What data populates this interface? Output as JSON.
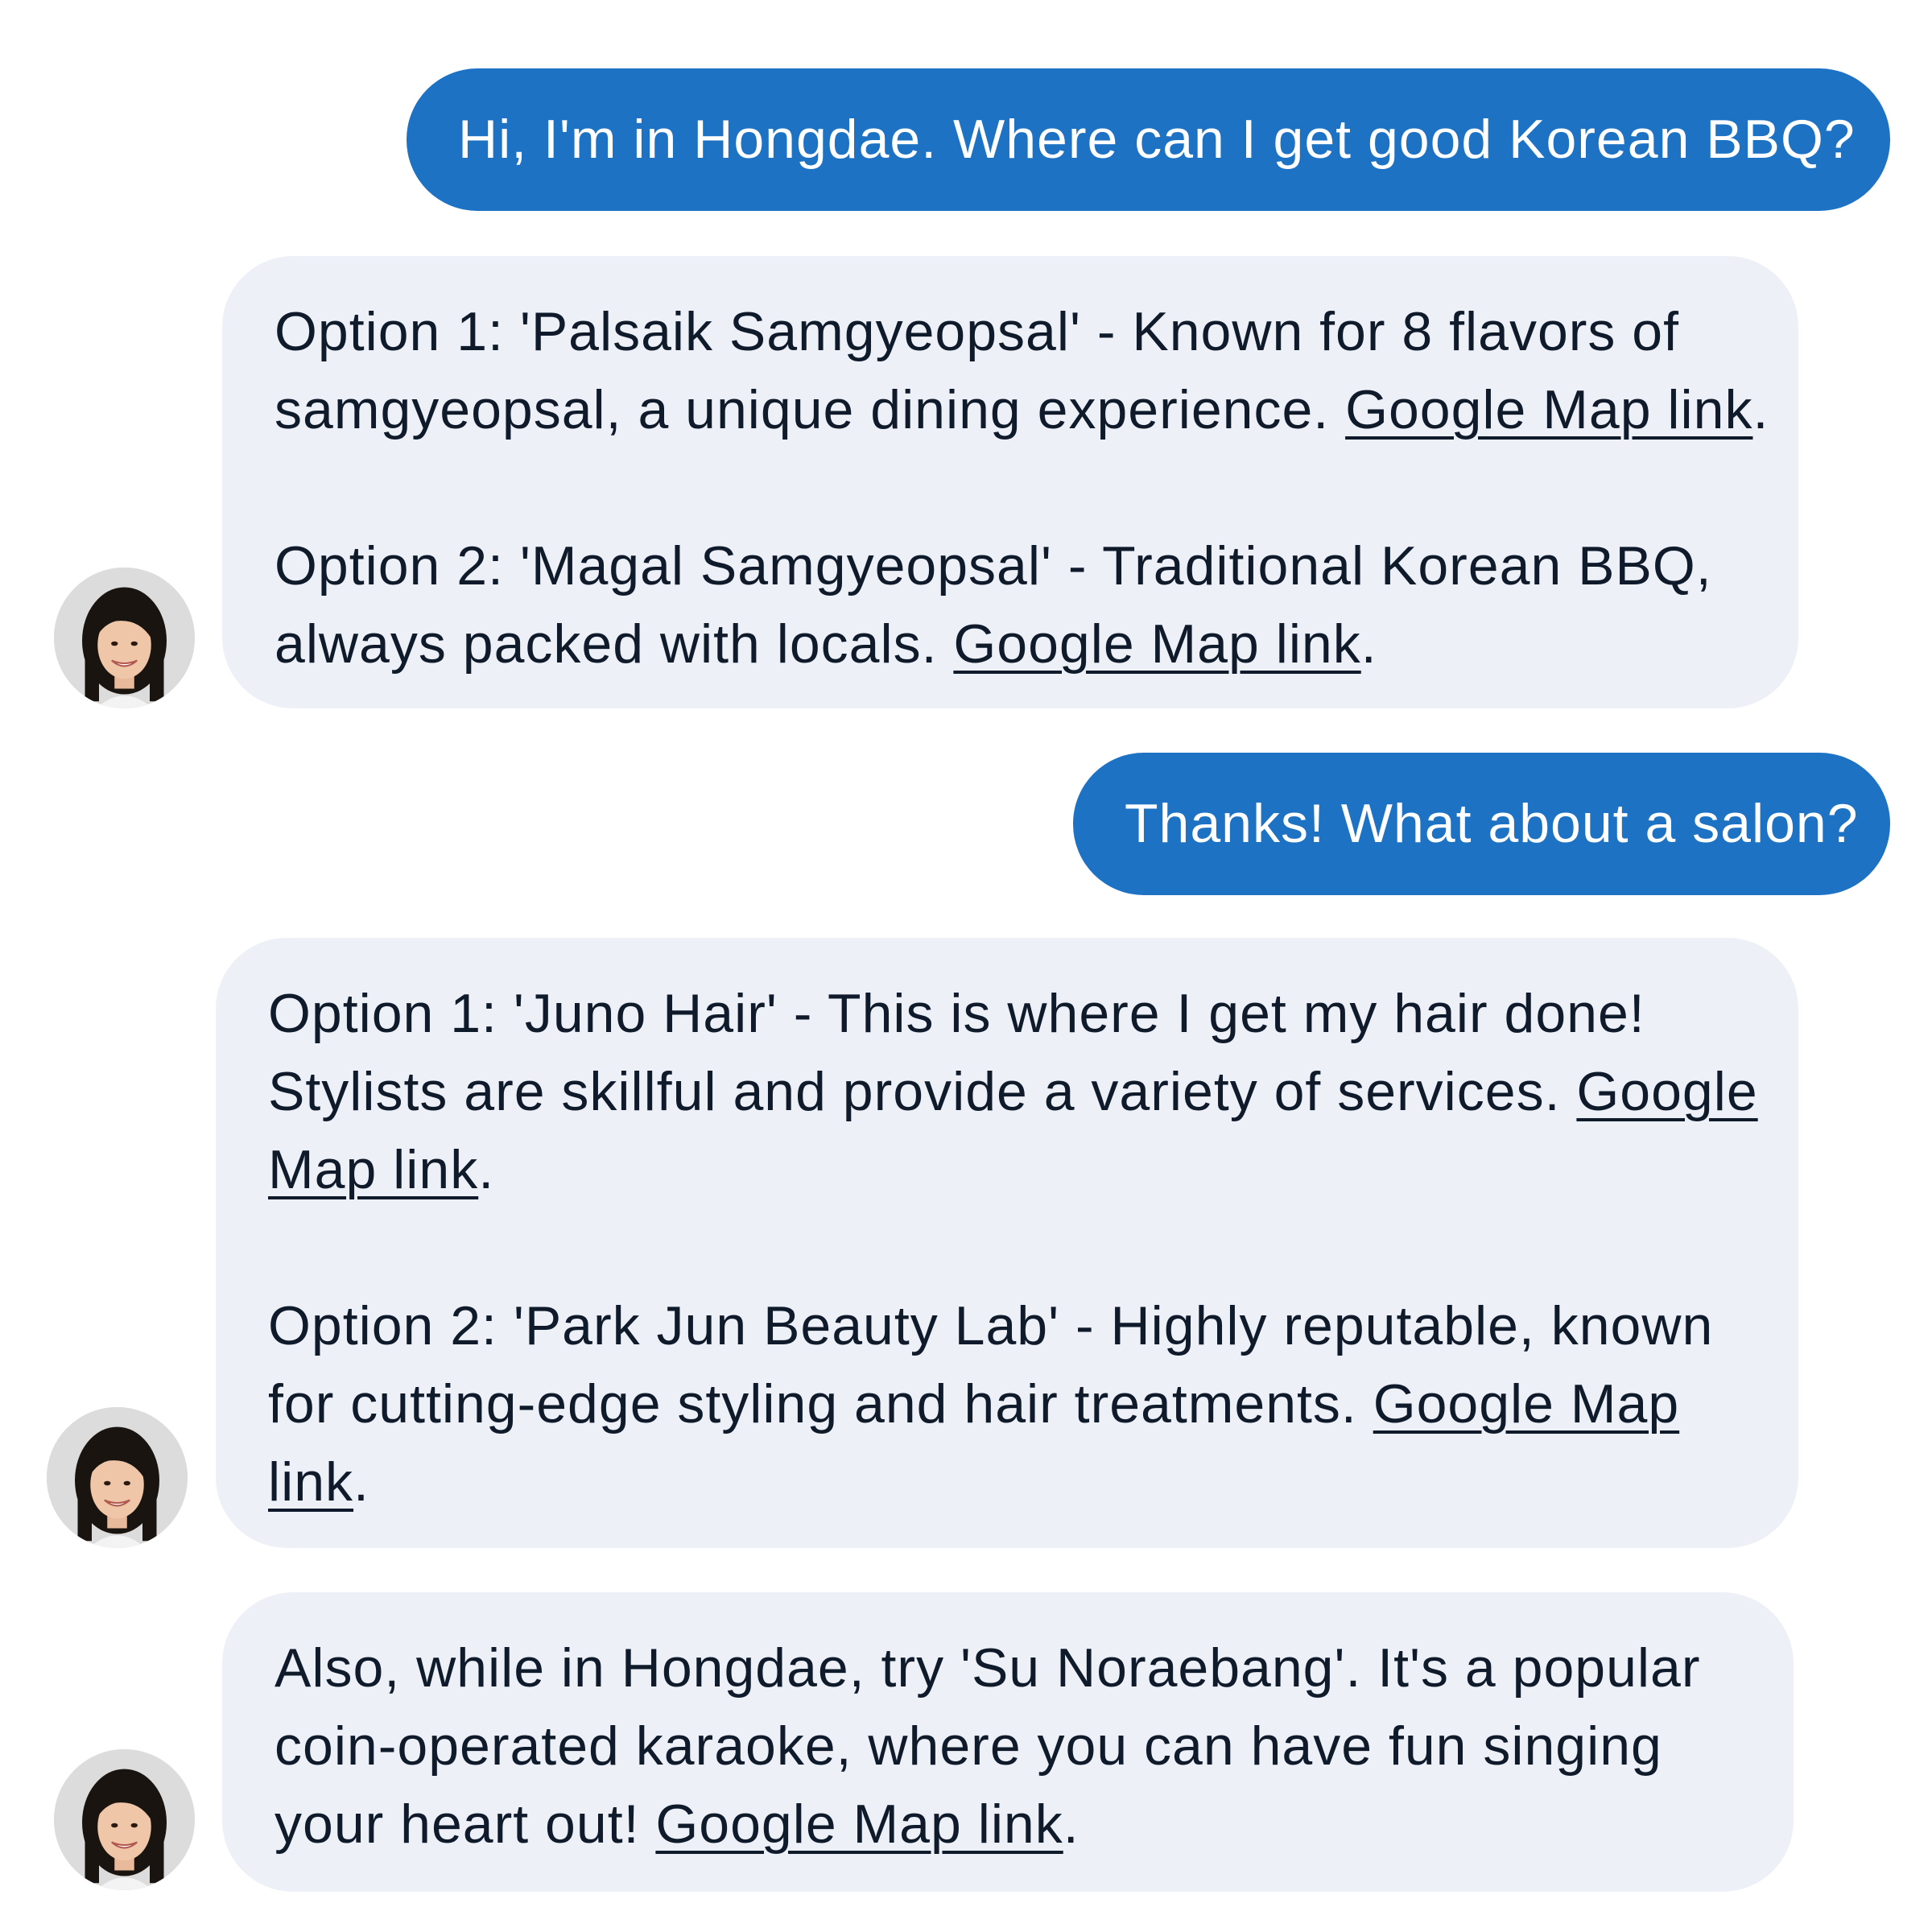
{
  "colors": {
    "user_bubble": "#1d72c4",
    "assistant_bubble": "#eef0f7",
    "assistant_text": "#0f1b2b",
    "user_text": "#ffffff"
  },
  "messages": [
    {
      "role": "user",
      "text": "Hi, I'm in Hongdae. Where can I get good Korean BBQ?"
    },
    {
      "role": "assistant",
      "avatar_icon": "person-avatar-icon",
      "options": [
        {
          "line1": "Option 1: 'Palsaik Samgyeopsal' - Known for 8 flavors of",
          "line2": "samgyeopsal, a unique dining experience. ",
          "link": "Google Map link"
        },
        {
          "line1": "Option 2: 'Magal Samgyeopsal' - Traditional Korean BBQ,",
          "line2": "always packed with locals. ",
          "link": "Google Map link"
        }
      ]
    },
    {
      "role": "user",
      "text": "Thanks! What about a salon?"
    },
    {
      "role": "assistant",
      "avatar_icon": "person-avatar-icon",
      "options": [
        {
          "line1": "Option 1: 'Juno Hair' - This is where I get my hair done!",
          "line2": "Stylists are skillful and provide a variety of services. ",
          "link_part1": "Google",
          "link_part2": "Map link"
        },
        {
          "line1": "Option 2: 'Park Jun Beauty Lab' - Highly reputable, known",
          "line2": "for cutting-edge styling and hair treatments. ",
          "link_part1": "Google Map",
          "link_part2": "link"
        }
      ]
    },
    {
      "role": "assistant",
      "avatar_icon": "person-avatar-icon",
      "line1": "Also, while in Hongdae, try 'Su Noraebang'. It's a popular",
      "line2": "coin-operated karaoke, where you can have fun singing",
      "line3": "your heart out! ",
      "link": "Google Map link"
    }
  ],
  "period": "."
}
